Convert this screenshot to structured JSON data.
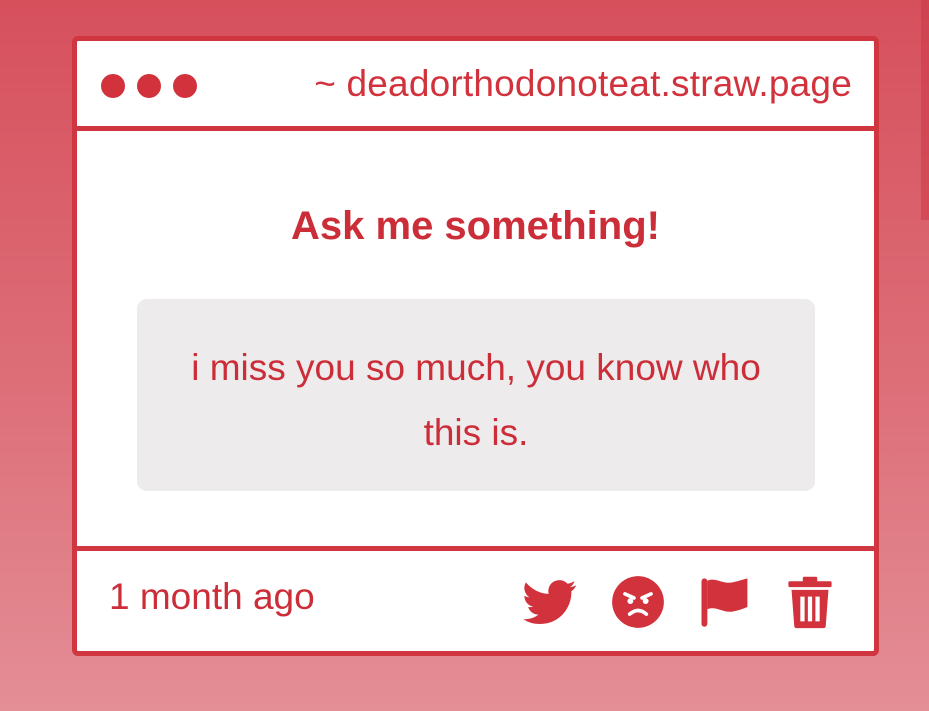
{
  "window": {
    "url": "~ deadorthodonoteat.straw.page"
  },
  "main": {
    "heading": "Ask me something!",
    "question": "i miss you so much, you know who this is."
  },
  "footer": {
    "timestamp": "1 month ago",
    "icons": [
      "twitter-icon",
      "angry-face-icon",
      "flag-icon",
      "trash-icon"
    ]
  },
  "colors": {
    "accent": "#d1323c",
    "background_top": "#d6505c",
    "background_bottom": "#e48e96",
    "question_box": "#edebec"
  }
}
